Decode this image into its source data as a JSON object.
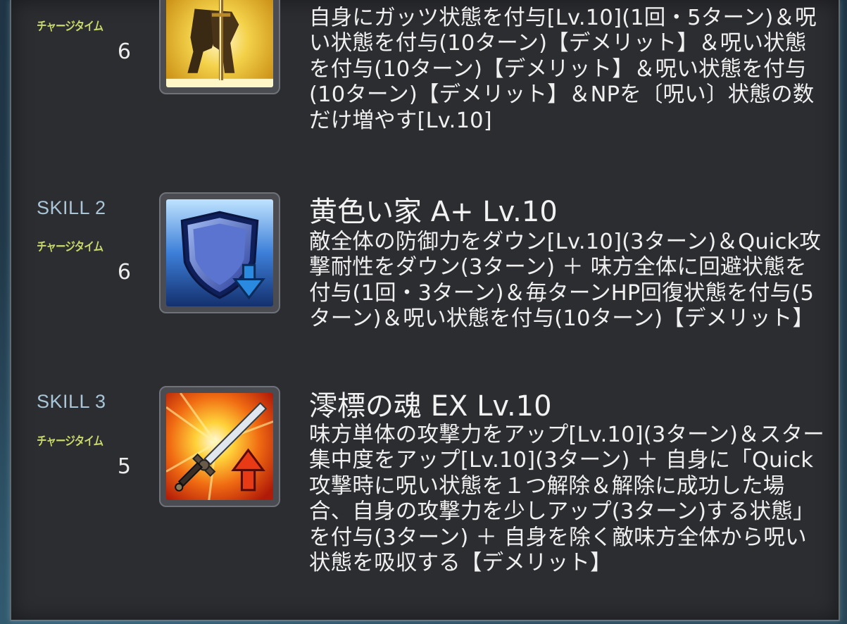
{
  "skills": [
    {
      "label": "",
      "charge_label": "チャージタイム",
      "charge_value": "6",
      "name": "",
      "icon": "kneeling-warrior-sword-icon",
      "description": "自身にガッツ状態を付与[Lv.10](1回・5ターン)＆呪い状態を付与(10ターン)【デメリット】＆呪い状態を付与(10ターン)【デメリット】＆呪い状態を付与(10ターン)【デメリット】＆NPを〔呪い〕状態の数だけ増やす[Lv.10]"
    },
    {
      "label": "SKILL 2",
      "charge_label": "チャージタイム",
      "charge_value": "6",
      "name": "黄色い家 A+ Lv.10",
      "icon": "shield-down-arrow-icon",
      "description": "敵全体の防御力をダウン[Lv.10](3ターン)＆Quick攻撃耐性をダウン(3ターン) ＋ 味方全体に回避状態を付与(1回・3ターン)＆毎ターンHP回復状態を付与(5ターン)＆呪い状態を付与(10ターン)【デメリット】"
    },
    {
      "label": "SKILL 3",
      "charge_label": "チャージタイム",
      "charge_value": "5",
      "name": "澪標の魂 EX Lv.10",
      "icon": "sword-up-arrow-icon",
      "description": "味方単体の攻撃力をアップ[Lv.10](3ターン)＆スター集中度をアップ[Lv.10](3ターン) ＋ 自身に「Quick攻撃時に呪い状態を１つ解除＆解除に成功した場合、自身の攻撃力を少しアップ(3ターン)する状態」を付与(3ターン) ＋ 自身を除く敵味方全体から呪い状態を吸収する【デメリット】"
    }
  ],
  "colors": {
    "panel_bg": "#2c2d31",
    "skill_label": "#a9c6d8",
    "charge_label": "#c9d86a",
    "text": "#f0f0f0"
  }
}
